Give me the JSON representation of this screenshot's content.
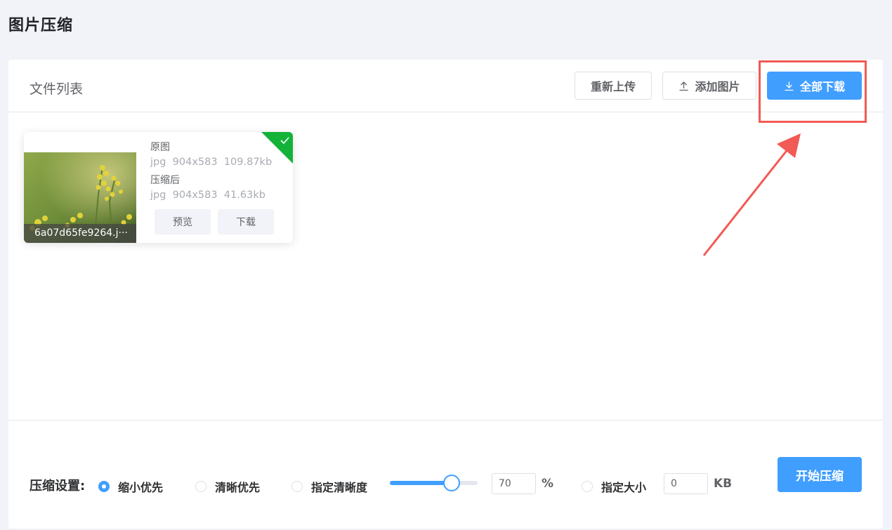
{
  "page": {
    "title": "图片压缩"
  },
  "file_list": {
    "title": "文件列表",
    "buttons": {
      "reupload": "重新上传",
      "add_images": "添加图片",
      "download_all": "全部下载"
    }
  },
  "file_card": {
    "filename": "6a07d65fe9264.j···",
    "original_label": "原图",
    "original_meta": "jpg  904x583  109.87kb",
    "compressed_label": "压缩后",
    "compressed_meta": "jpg  904x583  41.63kb",
    "preview_label": "预览",
    "download_label": "下载",
    "status": "completed"
  },
  "settings": {
    "label": "压缩设置:",
    "options": [
      "缩小优先",
      "清晰优先",
      "指定清晰度",
      "指定大小"
    ],
    "selected": "缩小优先",
    "quality_value": "70",
    "quality_unit": "%",
    "size_value": "0",
    "size_unit": "KB",
    "start_label": "开始压缩"
  },
  "colors": {
    "accent": "#409eff",
    "success": "#13b33a",
    "annotation": "#f25a55"
  }
}
